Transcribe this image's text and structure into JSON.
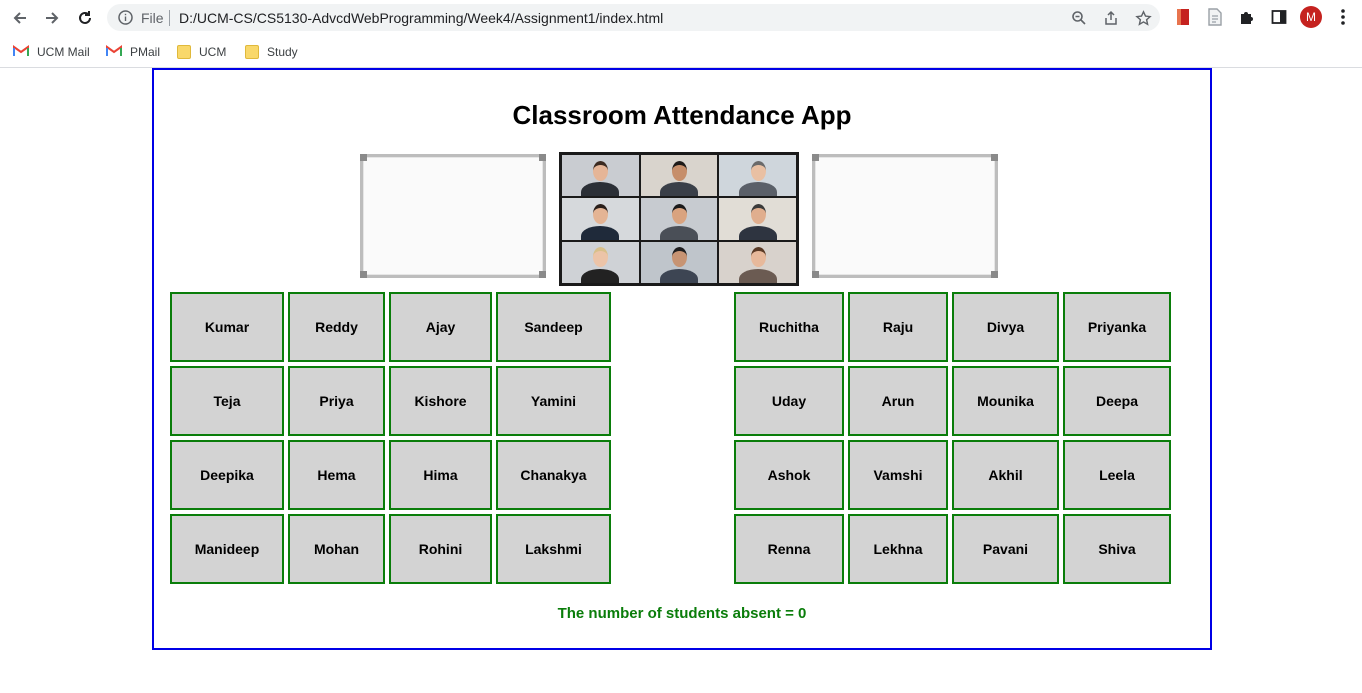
{
  "browser": {
    "scheme": "File",
    "url": "D:/UCM-CS/CS5130-AdvcdWebProgramming/Week4/Assignment1/index.html",
    "avatar_letter": "M",
    "bookmarks": [
      {
        "label": "UCM Mail",
        "icon": "gmail-icon"
      },
      {
        "label": "PMail",
        "icon": "gmail-icon"
      },
      {
        "label": "UCM",
        "icon": "folder-icon"
      },
      {
        "label": "Study",
        "icon": "folder-icon"
      }
    ]
  },
  "app": {
    "title": "Classroom Attendance App",
    "absent_text": "The number of students absent = 0",
    "colors": {
      "frame": "#0000e6",
      "seat_border": "#0a7d0a",
      "seat_bg": "#d3d3d3",
      "status": "#0a7d0a"
    },
    "left_seats": [
      [
        "Kumar",
        "Reddy",
        "Ajay",
        "Sandeep"
      ],
      [
        "Teja",
        "Priya",
        "Kishore",
        "Yamini"
      ],
      [
        "Deepika",
        "Hema",
        "Hima",
        "Chanakya"
      ],
      [
        "Manideep",
        "Mohan",
        "Rohini",
        "Lakshmi"
      ]
    ],
    "right_seats": [
      [
        "Ruchitha",
        "Raju",
        "Divya",
        "Priyanka"
      ],
      [
        "Uday",
        "Arun",
        "Mounika",
        "Deepa"
      ],
      [
        "Ashok",
        "Vamshi",
        "Akhil",
        "Leela"
      ],
      [
        "Renna",
        "Lekhna",
        "Pavani",
        "Shiva"
      ]
    ]
  }
}
